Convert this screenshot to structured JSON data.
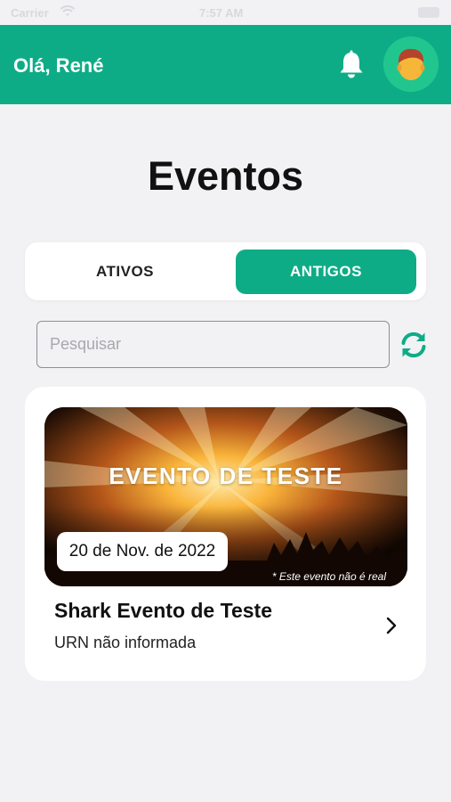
{
  "status_bar": {
    "carrier": "Carrier",
    "time": "7:57 AM"
  },
  "header": {
    "greeting": "Olá, René",
    "bell_icon": "bell-icon",
    "avatar_icon": "avatar-icon",
    "accent_color": "#0eac86"
  },
  "page": {
    "title": "Eventos"
  },
  "tabs": [
    {
      "label": "ATIVOS",
      "active": false
    },
    {
      "label": "ANTIGOS",
      "active": true
    }
  ],
  "search": {
    "placeholder": "Pesquisar",
    "value": "",
    "refresh_icon": "refresh-icon"
  },
  "events": [
    {
      "banner_title": "EVENTO DE TESTE",
      "date": "20 de Nov. de 2022",
      "disclaimer": "* Este evento não é real",
      "title": "Shark Evento de Teste",
      "subtitle": "URN não informada",
      "chevron_icon": "chevron-right-icon"
    }
  ]
}
